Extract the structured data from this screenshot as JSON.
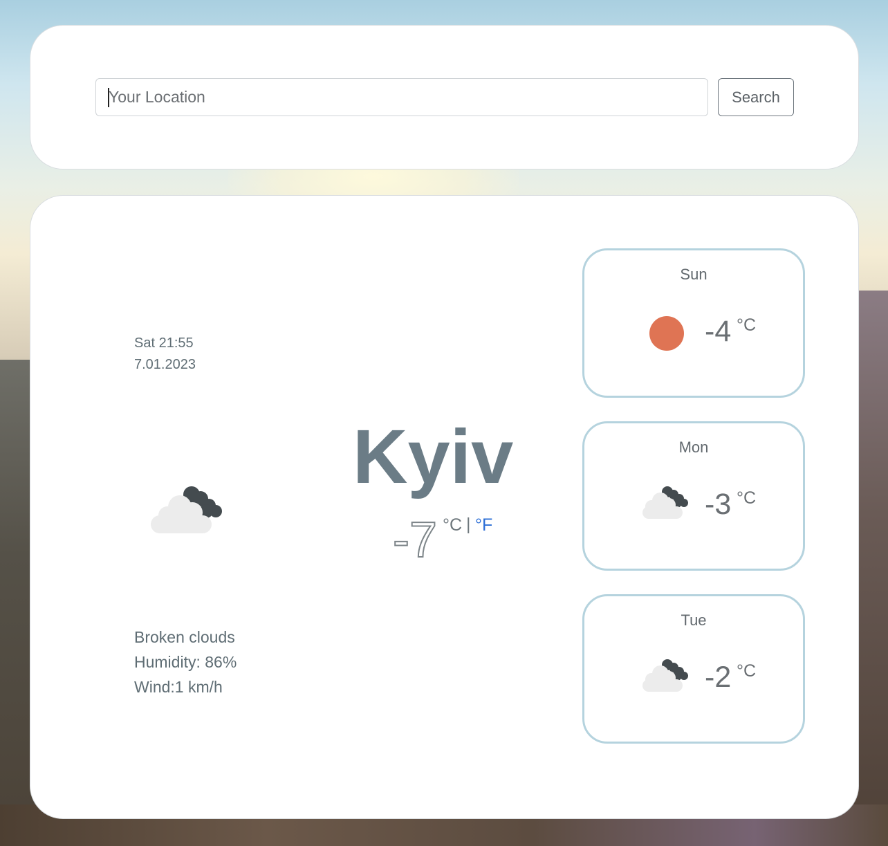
{
  "search": {
    "placeholder": "Your Location",
    "button_label": "Search"
  },
  "current": {
    "day_time": "Sat 21:55",
    "date": "7.01.2023",
    "icon": "broken-clouds-icon",
    "city": "Kyiv",
    "temperature": "-7",
    "unit_celsius": "°C",
    "unit_separator": "|",
    "unit_fahrenheit": "°F",
    "description": "Broken clouds",
    "humidity": "Humidity: 86%",
    "wind": "Wind:1 km/h"
  },
  "forecast": [
    {
      "day": "Sun",
      "temp": "-4",
      "unit": "°C",
      "icon": "sun-icon"
    },
    {
      "day": "Mon",
      "temp": "-3",
      "unit": "°C",
      "icon": "broken-clouds-icon"
    },
    {
      "day": "Tue",
      "temp": "-2",
      "unit": "°C",
      "icon": "broken-clouds-icon"
    }
  ],
  "colors": {
    "accent_link": "#2d6fd6",
    "sun": "#df7454",
    "forecast_border": "#b5d3de",
    "city_text": "#6b7c86"
  }
}
